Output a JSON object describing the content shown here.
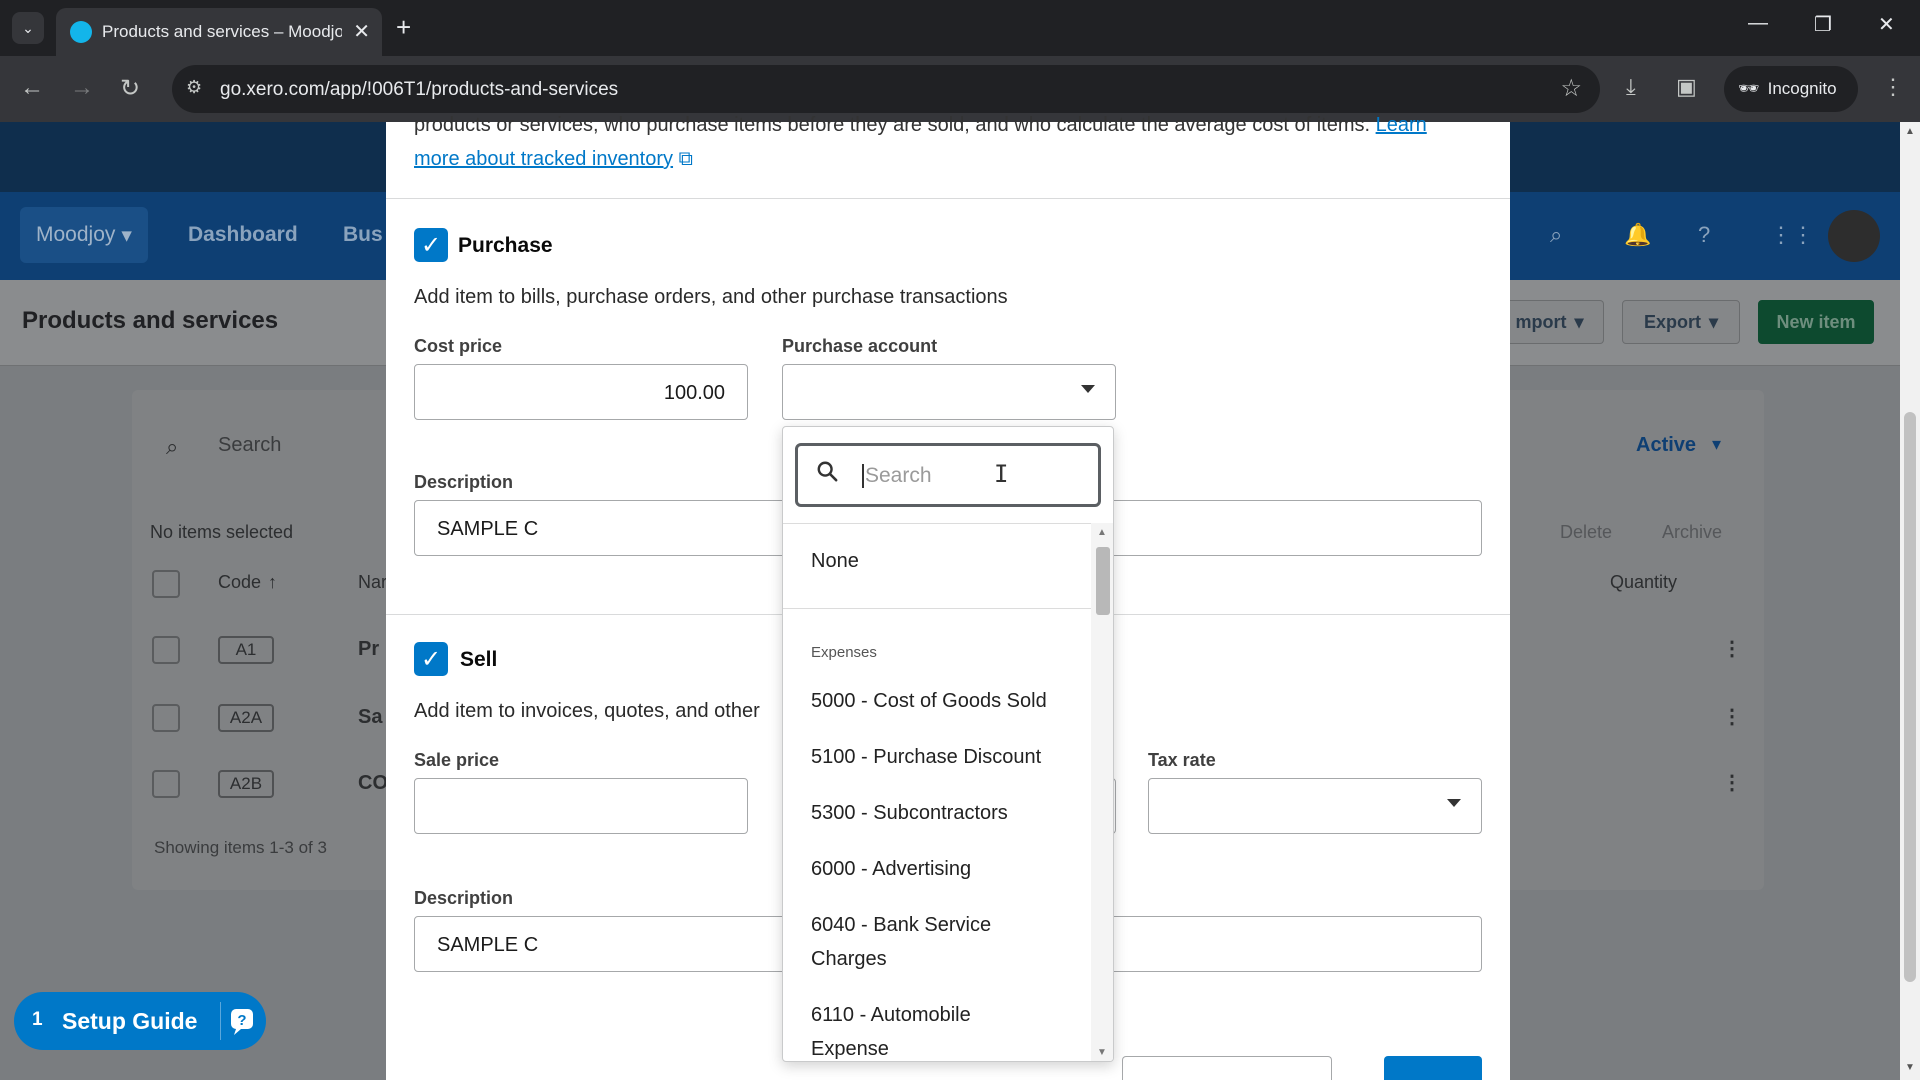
{
  "browser": {
    "tab_title": "Products and services – Moodjo",
    "url": "go.xero.com/app/!006T1/products-and-services",
    "profile": "Incognito"
  },
  "app": {
    "org_name": "Moodjoy",
    "nav": [
      "Dashboard",
      "Bus"
    ],
    "page_title": "Products and services",
    "buttons": {
      "import": "mport",
      "export": "Export",
      "new_item": "New item"
    },
    "search_placeholder": "Search",
    "filter": "Active",
    "selection_status": "No items selected",
    "bulk_actions": {
      "delete": "Delete",
      "archive": "Archive"
    },
    "columns": {
      "code": "Code",
      "name": "Nar",
      "quantity": "Quantity"
    },
    "rows": [
      {
        "code": "A1",
        "name": "Pr"
      },
      {
        "code": "A2A",
        "name": "Sa"
      },
      {
        "code": "A2B",
        "name": "CO"
      }
    ],
    "showing": "Showing items 1-3 of 3"
  },
  "modal": {
    "info_line": "products or services, who purchase items before they are sold, and who calculate the average cost of items.",
    "info_link_1": "Learn",
    "info_link_2": "more about tracked inventory",
    "purchase": {
      "title": "Purchase",
      "description": "Add item to bills, purchase orders, and other purchase transactions",
      "cost_price_label": "Cost price",
      "cost_price_value": "100.00",
      "account_label": "Purchase account",
      "account_value": "",
      "description_label": "Description",
      "description_value": "SAMPLE C"
    },
    "sell": {
      "title": "Sell",
      "description": "Add item to invoices, quotes, and other",
      "sale_price_label": "Sale price",
      "sale_price_value": "",
      "tax_rate_label": "Tax rate",
      "tax_rate_value": "",
      "description_label": "Description",
      "description_value": "SAMPLE C"
    }
  },
  "dropdown": {
    "search_placeholder": "Search",
    "none_option": "None",
    "group_label": "Expenses",
    "options": [
      "5000 - Cost of Goods Sold",
      "5100 - Purchase Discount",
      "5300 - Subcontractors",
      "6000 - Advertising",
      "6040 - Bank Service Charges",
      "6110 - Automobile Expense"
    ]
  },
  "setup_guide": {
    "count": "1",
    "label": "Setup Guide"
  },
  "colors": {
    "accent": "#0078c8",
    "nav": "#0e3f73",
    "primary_button": "#0d4a2f"
  }
}
